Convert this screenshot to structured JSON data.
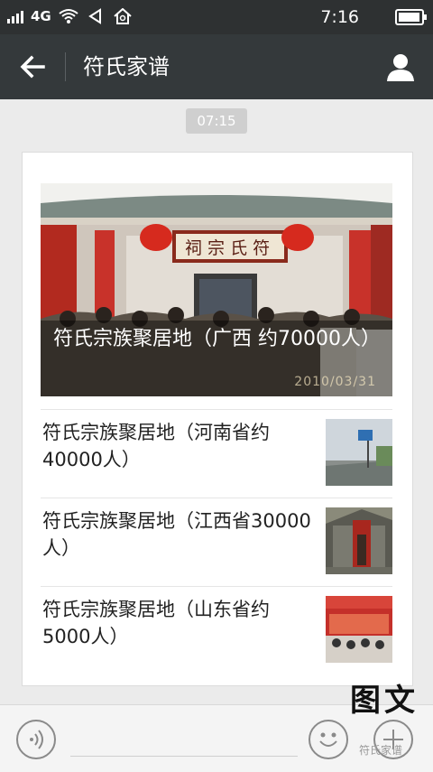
{
  "status_bar": {
    "network": "4G",
    "time": "7:16",
    "battery_level": 0.95
  },
  "header": {
    "title": "符氏家谱"
  },
  "message": {
    "time": "07:15",
    "cover": {
      "title": "符氏宗族聚居地（广西 约70000人）",
      "photo_date_stamp": "2010/03/31"
    },
    "items": [
      {
        "title": "符氏宗族聚居地（河南省约40000人）"
      },
      {
        "title": "符氏宗族聚居地（江西省30000人）"
      },
      {
        "title": "符氏宗族聚居地（山东省约5000人）"
      }
    ]
  },
  "watermark": {
    "logo_text": "图文",
    "label": "符氏家谱"
  },
  "colors": {
    "status_bar": "#2e3132",
    "title_bar": "#34393b",
    "background": "#ebebeb",
    "card": "#ffffff"
  },
  "icons": {
    "back": "arrow-left-icon",
    "profile": "person-icon",
    "voice": "voice-icon",
    "emoji": "emoji-icon",
    "more": "plus-icon"
  }
}
